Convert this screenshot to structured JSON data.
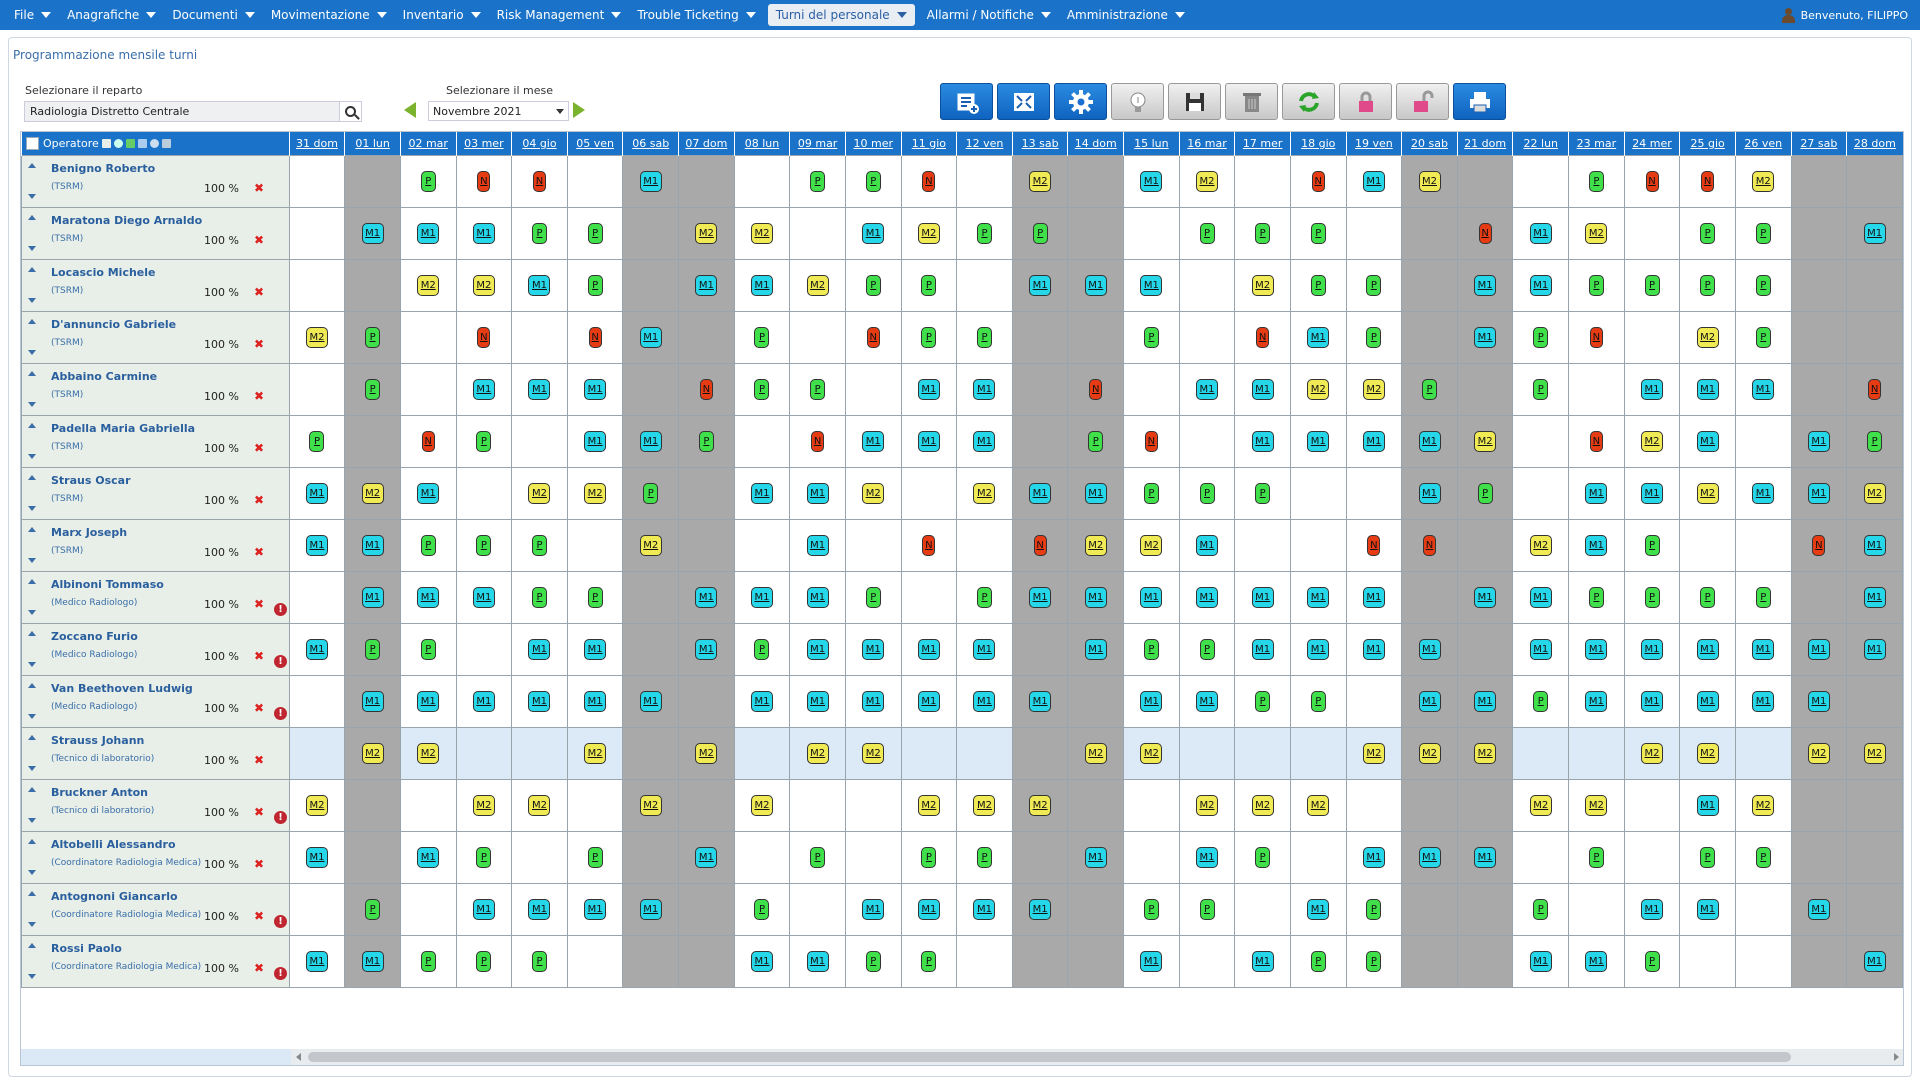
{
  "menu": [
    {
      "label": "File",
      "active": false
    },
    {
      "label": "Anagrafiche",
      "active": false
    },
    {
      "label": "Documenti",
      "active": false
    },
    {
      "label": "Movimentazione",
      "active": false
    },
    {
      "label": "Inventario",
      "active": false
    },
    {
      "label": "Risk Management",
      "active": false
    },
    {
      "label": "Trouble Ticketing",
      "active": false
    },
    {
      "label": "Turni del personale",
      "active": true
    },
    {
      "label": "Allarmi / Notifiche",
      "active": false
    },
    {
      "label": "Amministrazione",
      "active": false
    }
  ],
  "welcome": "Benvenuto, FILIPPO",
  "page_title": "Programmazione mensile turni",
  "controls": {
    "dept_label": "Selezionare il reparto",
    "dept_value": "Radiologia Distretto Centrale",
    "month_label": "Selezionare il mese",
    "month_value": "Novembre 2021"
  },
  "toolbar": [
    {
      "icon": "list-add-icon",
      "style": "blue"
    },
    {
      "icon": "fit-screen-icon",
      "style": "blue"
    },
    {
      "icon": "gear-icon",
      "style": "blue"
    },
    {
      "icon": "lightbulb-icon",
      "style": "gray"
    },
    {
      "icon": "floppy-save-icon",
      "style": "gray"
    },
    {
      "icon": "trash-icon",
      "style": "gray"
    },
    {
      "icon": "refresh-icon",
      "style": "gray"
    },
    {
      "icon": "lock-icon",
      "style": "gray"
    },
    {
      "icon": "unlock-icon",
      "style": "gray"
    },
    {
      "icon": "printer-icon",
      "style": "blue"
    }
  ],
  "grid": {
    "operator_header": "Operatore",
    "days": [
      "31 dom",
      "01 lun",
      "02 mar",
      "03 mer",
      "04 gio",
      "05 ven",
      "06 sab",
      "07 dom",
      "08 lun",
      "09 mar",
      "10 mer",
      "11 gio",
      "12 ven",
      "13 sab",
      "14 dom",
      "15 lun",
      "16 mar",
      "17 mer",
      "18 gio",
      "19 ven",
      "20 sab",
      "21 dom",
      "22 lun",
      "23 mar",
      "24 mer",
      "25 gio",
      "26 ven",
      "27 sab",
      "28 dom"
    ],
    "weekend_cols": [
      1,
      6,
      7,
      13,
      14,
      20,
      21,
      27,
      28
    ],
    "shift_labels": {
      "M1": "M1",
      "M2": "M2",
      "P": "P",
      "N": "N"
    },
    "colors": {
      "M1": "#25d7e8",
      "M2": "#f0ea55",
      "P": "#3fe04a",
      "N": "#e73b14",
      "header": "#1a73c8",
      "weekend": "#a9a9a9"
    },
    "rows": [
      {
        "name": "Benigno Roberto",
        "role": "(TSRM)",
        "pct": "100 %",
        "warn": false,
        "selected": false,
        "shifts": [
          "",
          "",
          "P",
          "N",
          "N",
          "",
          "M1",
          "",
          "",
          "P",
          "P",
          "N",
          "",
          "M2",
          "",
          "M1",
          "M2",
          "",
          "N",
          "M1",
          "M2",
          "",
          "",
          "P",
          "N",
          "N",
          "M2",
          "",
          ""
        ]
      },
      {
        "name": "Maratona Diego Arnaldo",
        "role": "(TSRM)",
        "pct": "100 %",
        "warn": false,
        "selected": false,
        "shifts": [
          "",
          "M1",
          "M1",
          "M1",
          "P",
          "P",
          "",
          "M2",
          "M2",
          "",
          "M1",
          "M2",
          "P",
          "P",
          "",
          "",
          "P",
          "P",
          "P",
          "",
          "",
          "N",
          "M1",
          "M2",
          "",
          "P",
          "P",
          "",
          "M1"
        ]
      },
      {
        "name": "Locascio Michele",
        "role": "(TSRM)",
        "pct": "100 %",
        "warn": false,
        "selected": false,
        "shifts": [
          "",
          "",
          "M2",
          "M2",
          "M1",
          "P",
          "",
          "M1",
          "M1",
          "M2",
          "P",
          "P",
          "",
          "M1",
          "M1",
          "M1",
          "",
          "M2",
          "P",
          "P",
          "",
          "M1",
          "M1",
          "P",
          "P",
          "P",
          "P",
          "",
          ""
        ]
      },
      {
        "name": "D'annuncio Gabriele",
        "role": "(TSRM)",
        "pct": "100 %",
        "warn": false,
        "selected": false,
        "shifts": [
          "M2",
          "P",
          "",
          "N",
          "",
          "N",
          "M1",
          "",
          "P",
          "",
          "N",
          "P",
          "P",
          "",
          "",
          "P",
          "",
          "N",
          "M1",
          "P",
          "",
          "M1",
          "P",
          "N",
          "",
          "M2",
          "P",
          "",
          ""
        ]
      },
      {
        "name": "Abbaino Carmine",
        "role": "(TSRM)",
        "pct": "100 %",
        "warn": false,
        "selected": false,
        "shifts": [
          "",
          "P",
          "",
          "M1",
          "M1",
          "M1",
          "",
          "N",
          "P",
          "P",
          "",
          "M1",
          "M1",
          "",
          "N",
          "",
          "M1",
          "M1",
          "M2",
          "M2",
          "P",
          "",
          "P",
          "",
          "M1",
          "M1",
          "M1",
          "",
          "N"
        ]
      },
      {
        "name": "Padella Maria Gabriella",
        "role": "(TSRM)",
        "pct": "100 %",
        "warn": false,
        "selected": false,
        "shifts": [
          "P",
          "",
          "N",
          "P",
          "",
          "M1",
          "M1",
          "P",
          "",
          "N",
          "M1",
          "M1",
          "M1",
          "",
          "P",
          "N",
          "",
          "M1",
          "M1",
          "M1",
          "M1",
          "M2",
          "",
          "N",
          "M2",
          "M1",
          "",
          "M1",
          "P"
        ]
      },
      {
        "name": "Straus Oscar",
        "role": "(TSRM)",
        "pct": "100 %",
        "warn": false,
        "selected": false,
        "shifts": [
          "M1",
          "M2",
          "M1",
          "",
          "M2",
          "M2",
          "P",
          "",
          "M1",
          "M1",
          "M2",
          "",
          "M2",
          "M1",
          "M1",
          "P",
          "P",
          "P",
          "",
          "",
          "M1",
          "P",
          "",
          "M1",
          "M1",
          "M2",
          "M1",
          "M1",
          "M2"
        ]
      },
      {
        "name": "Marx Joseph",
        "role": "(TSRM)",
        "pct": "100 %",
        "warn": false,
        "selected": false,
        "shifts": [
          "M1",
          "M1",
          "P",
          "P",
          "P",
          "",
          "M2",
          "",
          "",
          "M1",
          "",
          "N",
          "",
          "N",
          "M2",
          "M2",
          "M1",
          "",
          "",
          "N",
          "N",
          "",
          "M2",
          "M1",
          "P",
          "",
          "",
          "N",
          "M1"
        ]
      },
      {
        "name": "Albinoni Tommaso",
        "role": "(Medico Radiologo)",
        "pct": "100 %",
        "warn": true,
        "selected": false,
        "shifts": [
          "",
          "M1",
          "M1",
          "M1",
          "P",
          "P",
          "",
          "M1",
          "M1",
          "M1",
          "P",
          "",
          "P",
          "M1",
          "M1",
          "M1",
          "M1",
          "M1",
          "M1",
          "M1",
          "",
          "M1",
          "M1",
          "P",
          "P",
          "P",
          "P",
          "",
          "M1"
        ]
      },
      {
        "name": "Zoccano Furio",
        "role": "(Medico Radiologo)",
        "pct": "100 %",
        "warn": true,
        "selected": false,
        "shifts": [
          "M1",
          "P",
          "P",
          "",
          "M1",
          "M1",
          "",
          "M1",
          "P",
          "M1",
          "M1",
          "M1",
          "M1",
          "",
          "M1",
          "P",
          "P",
          "M1",
          "M1",
          "M1",
          "M1",
          "",
          "M1",
          "M1",
          "M1",
          "M1",
          "M1",
          "M1",
          "M1"
        ]
      },
      {
        "name": "Van Beethoven Ludwig",
        "role": "(Medico Radiologo)",
        "pct": "100 %",
        "warn": true,
        "selected": false,
        "shifts": [
          "",
          "M1",
          "M1",
          "M1",
          "M1",
          "M1",
          "M1",
          "",
          "M1",
          "M1",
          "M1",
          "M1",
          "M1",
          "M1",
          "",
          "M1",
          "M1",
          "P",
          "P",
          "",
          "M1",
          "M1",
          "P",
          "M1",
          "M1",
          "M1",
          "M1",
          "M1",
          ""
        ]
      },
      {
        "name": "Strauss Johann",
        "role": "(Tecnico di laboratorio)",
        "pct": "100 %",
        "warn": false,
        "selected": true,
        "shifts": [
          "",
          "M2",
          "M2",
          "",
          "",
          "M2",
          "",
          "M2",
          "",
          "M2",
          "M2",
          "",
          "",
          "",
          "M2",
          "M2",
          "",
          "",
          "",
          "M2",
          "M2",
          "M2",
          "",
          "",
          "M2",
          "M2",
          "",
          "M2",
          "M2"
        ]
      },
      {
        "name": "Bruckner Anton",
        "role": "(Tecnico di laboratorio)",
        "pct": "100 %",
        "warn": true,
        "selected": false,
        "shifts": [
          "M2",
          "",
          "",
          "M2",
          "M2",
          "",
          "M2",
          "",
          "M2",
          "",
          "",
          "M2",
          "M2",
          "M2",
          "",
          "",
          "M2",
          "M2",
          "M2",
          "",
          "",
          "",
          "M2",
          "M2",
          "",
          "M1",
          "M2",
          "",
          ""
        ]
      },
      {
        "name": "Altobelli Alessandro",
        "role": "(Coordinatore Radiologia Medica)",
        "pct": "100 %",
        "warn": false,
        "selected": false,
        "shifts": [
          "M1",
          "",
          "M1",
          "P",
          "",
          "P",
          "",
          "M1",
          "",
          "P",
          "",
          "P",
          "P",
          "",
          "M1",
          "",
          "M1",
          "P",
          "",
          "M1",
          "M1",
          "M1",
          "",
          "P",
          "",
          "P",
          "P",
          "",
          ""
        ]
      },
      {
        "name": "Antognoni Giancarlo",
        "role": "(Coordinatore Radiologia Medica)",
        "pct": "100 %",
        "warn": true,
        "selected": false,
        "shifts": [
          "",
          "P",
          "",
          "M1",
          "M1",
          "M1",
          "M1",
          "",
          "P",
          "",
          "M1",
          "M1",
          "M1",
          "M1",
          "",
          "P",
          "P",
          "",
          "M1",
          "P",
          "",
          "",
          "P",
          "",
          "M1",
          "M1",
          "",
          "M1",
          ""
        ]
      },
      {
        "name": "Rossi Paolo",
        "role": "(Coordinatore Radiologia Medica)",
        "pct": "100 %",
        "warn": true,
        "selected": false,
        "shifts": [
          "M1",
          "M1",
          "P",
          "P",
          "P",
          "",
          "",
          "",
          "M1",
          "M1",
          "P",
          "P",
          "",
          "",
          "",
          "M1",
          "",
          "M1",
          "P",
          "P",
          "",
          "",
          "M1",
          "M1",
          "P",
          "",
          "",
          "",
          "M1"
        ]
      }
    ]
  }
}
